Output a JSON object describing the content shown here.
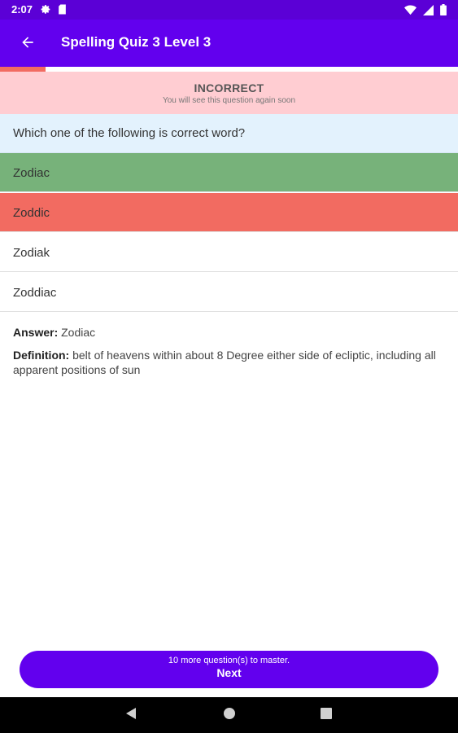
{
  "status_bar": {
    "time": "2:07"
  },
  "app_bar": {
    "title": "Spelling Quiz 3 Level 3"
  },
  "progress": {
    "fraction": 0.1
  },
  "feedback": {
    "title": "INCORRECT",
    "subtitle": "You will see this question again soon"
  },
  "question": {
    "text": "Which one of the following is correct word?"
  },
  "options": [
    {
      "label": "Zodiac",
      "state": "correct",
      "bg": "#77b27a"
    },
    {
      "label": "Zoddic",
      "state": "wrong",
      "bg": "#f26b61"
    },
    {
      "label": "Zodiak",
      "state": "neutral",
      "bg": "#ffffff"
    },
    {
      "label": "Zoddiac",
      "state": "neutral",
      "bg": "#ffffff"
    }
  ],
  "answer": {
    "label": "Answer:",
    "value": "Zodiac"
  },
  "definition": {
    "label": "Definition:",
    "value": "belt of heavens within about 8 Degree either side of ecliptic, including all apparent positions of sun"
  },
  "next_button": {
    "subtitle": "10 more question(s) to master.",
    "label": "Next"
  },
  "colors": {
    "primary": "#6200ee",
    "status": "#5b00d6",
    "incorrect_bg": "#ffcdd2",
    "question_bg": "#e3f2fd"
  },
  "icons": [
    "gear-icon",
    "sd-card-icon",
    "wifi-icon",
    "signal-icon",
    "battery-icon",
    "back-arrow-icon",
    "nav-back-icon",
    "nav-home-icon",
    "nav-recents-icon"
  ]
}
